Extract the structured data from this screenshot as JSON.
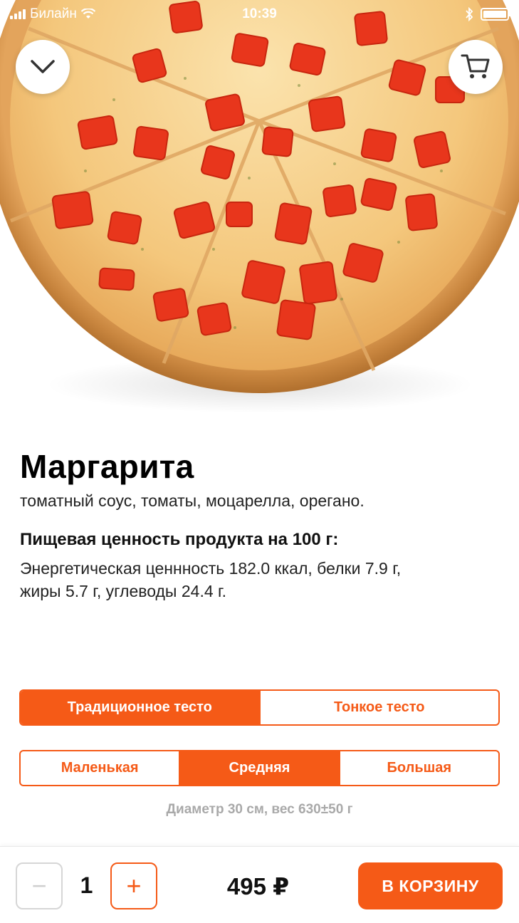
{
  "status_bar": {
    "carrier": "Билайн",
    "time": "10:39"
  },
  "header": {
    "collapse_icon": "chevron-down-icon",
    "cart_icon": "cart-icon"
  },
  "product": {
    "title": "Маргарита",
    "ingredients": "томатный соус, томаты, моцарелла, орегано.",
    "nutrition_heading": "Пищевая ценность продукта на 100 г:",
    "nutrition_line1": "Энергетическая ценнность 182.0 ккал, белки 7.9 г,",
    "nutrition_line2": "жиры 5.7 г, углеводы 24.4 г."
  },
  "dough_options": [
    {
      "label": "Традиционное тесто",
      "selected": true
    },
    {
      "label": "Тонкое тесто",
      "selected": false
    }
  ],
  "size_options": [
    {
      "label": "Маленькая",
      "selected": false
    },
    {
      "label": "Средняя",
      "selected": true
    },
    {
      "label": "Большая",
      "selected": false
    }
  ],
  "size_info": "Диаметр 30 см, вес 630±50 г",
  "order": {
    "minus_label": "−",
    "plus_label": "+",
    "quantity": "1",
    "price": "495 ₽",
    "add_to_cart_label": "В КОРЗИНУ"
  },
  "colors": {
    "accent": "#f55a17"
  }
}
